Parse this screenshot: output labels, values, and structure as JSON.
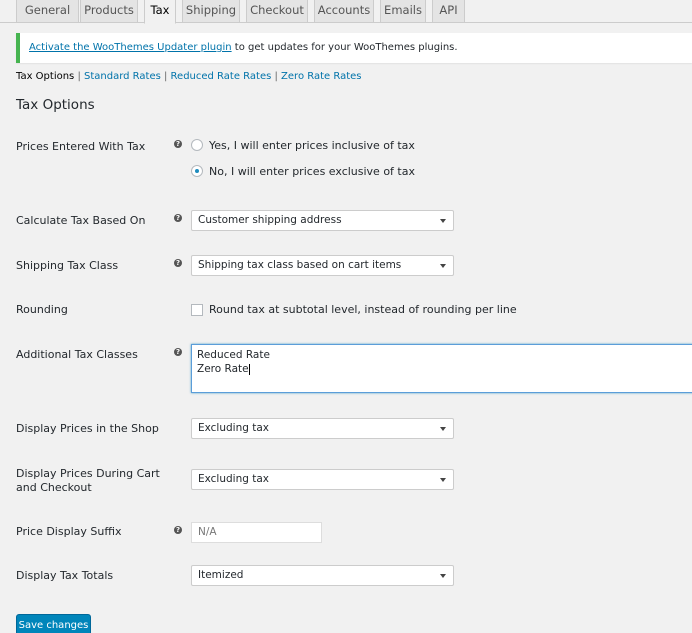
{
  "tabs": [
    {
      "label": "General",
      "active": false
    },
    {
      "label": "Products",
      "active": false
    },
    {
      "label": "Tax",
      "active": true
    },
    {
      "label": "Shipping",
      "active": false
    },
    {
      "label": "Checkout",
      "active": false
    },
    {
      "label": "Accounts",
      "active": false
    },
    {
      "label": "Emails",
      "active": false
    },
    {
      "label": "API",
      "active": false
    }
  ],
  "notice": {
    "link": "Activate the WooThemes Updater plugin",
    "text": " to get updates for your WooThemes plugins."
  },
  "subsubsub": {
    "current": "Tax Options",
    "links": [
      "Standard Rates",
      "Reduced Rate Rates",
      "Zero Rate Rates"
    ],
    "separator": " | "
  },
  "section_title": "Tax Options",
  "fields": {
    "prices_entered": {
      "label": "Prices Entered With Tax",
      "options": [
        "Yes, I will enter prices inclusive of tax",
        "No, I will enter prices exclusive of tax"
      ],
      "selected": "No, I will enter prices exclusive of tax"
    },
    "calc_based_on": {
      "label": "Calculate Tax Based On",
      "value": "Customer shipping address"
    },
    "shipping_tax_class": {
      "label": "Shipping Tax Class",
      "value": "Shipping tax class based on cart items"
    },
    "rounding": {
      "label": "Rounding",
      "checkbox_label": "Round tax at subtotal level, instead of rounding per line",
      "checked": false
    },
    "additional_classes": {
      "label": "Additional Tax Classes",
      "lines": [
        "Reduced Rate",
        "Zero Rate"
      ]
    },
    "display_shop": {
      "label": "Display Prices in the Shop",
      "value": "Excluding tax"
    },
    "display_cart": {
      "label": "Display Prices During Cart and Checkout",
      "value": "Excluding tax"
    },
    "suffix": {
      "label": "Price Display Suffix",
      "placeholder": "N/A"
    },
    "tax_totals": {
      "label": "Display Tax Totals",
      "value": "Itemized"
    }
  },
  "help_icon": "?",
  "save_button": "Save changes",
  "colors": {
    "accent": "#0073aa",
    "notice_border": "#46b450",
    "button": "#0085ba"
  }
}
